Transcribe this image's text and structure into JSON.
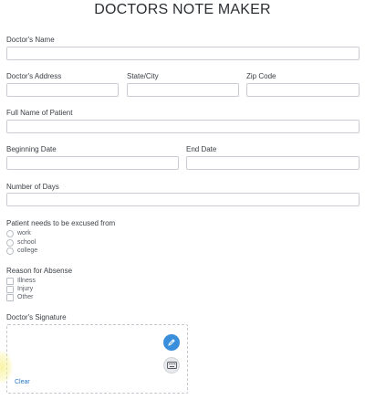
{
  "page": {
    "title": "DOCTORS NOTE MAKER"
  },
  "fields": {
    "doctor_name": {
      "label": "Doctor's Name",
      "value": ""
    },
    "doctor_address": {
      "label": "Doctor's Address",
      "value": ""
    },
    "state_city": {
      "label": "State/City",
      "value": ""
    },
    "zip_code": {
      "label": "Zip Code",
      "value": ""
    },
    "patient_name": {
      "label": "Full Name of Patient",
      "value": ""
    },
    "beginning_date": {
      "label": "Beginning Date",
      "value": ""
    },
    "end_date": {
      "label": "End Date",
      "value": ""
    },
    "number_of_days": {
      "label": "Number of Days",
      "value": ""
    }
  },
  "excused": {
    "label": "Patient needs to be excused from",
    "options": [
      "work",
      "school",
      "college"
    ]
  },
  "reason": {
    "label": "Reason for Absense",
    "options": [
      "Illness",
      "Injury",
      "Other"
    ]
  },
  "signature": {
    "label": "Doctor's Signature",
    "clear_label": "Clear",
    "pen_icon": "pen-icon",
    "keyboard_icon": "keyboard-icon"
  },
  "colors": {
    "accent": "#3a8fdc",
    "link": "#2a78c9",
    "border": "#c9cdd3"
  }
}
